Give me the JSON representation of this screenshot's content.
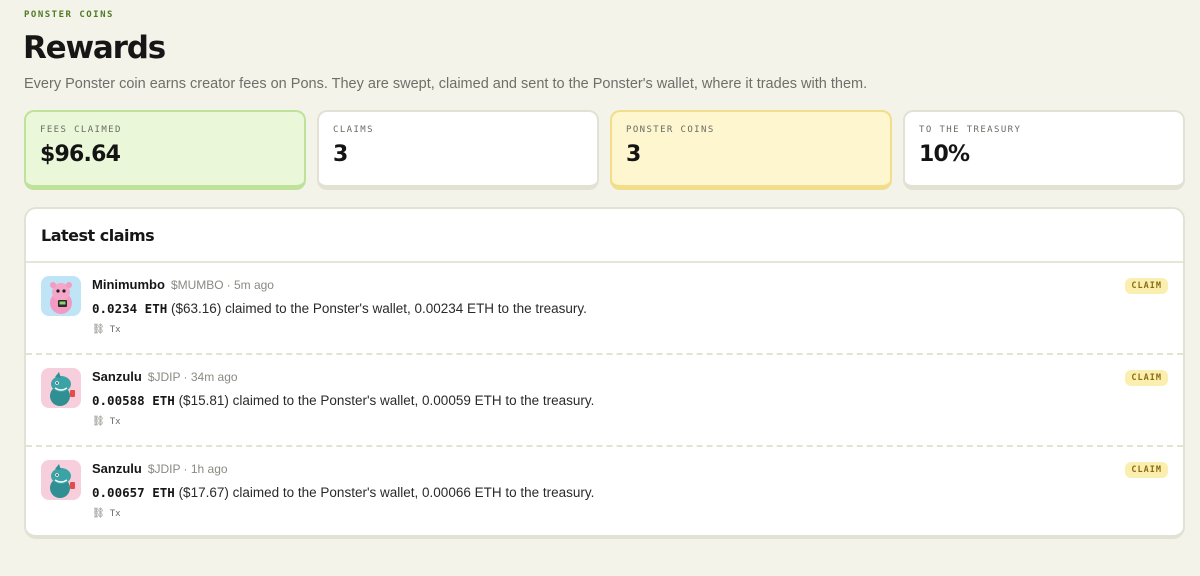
{
  "header": {
    "eyebrow": "PONSTER COINS",
    "title": "Rewards",
    "subtitle": "Every Ponster coin earns creator fees on Pons. They are swept, claimed and sent to the Ponster's wallet, where it trades with them."
  },
  "stats": [
    {
      "label": "FEES CLAIMED",
      "value": "$96.64",
      "tone": "green"
    },
    {
      "label": "CLAIMS",
      "value": "3",
      "tone": "white"
    },
    {
      "label": "PONSTER COINS",
      "value": "3",
      "tone": "yellow"
    },
    {
      "label": "TO THE TREASURY",
      "value": "10%",
      "tone": "white"
    }
  ],
  "claims_panel": {
    "title": "Latest claims",
    "rows": [
      {
        "name": "Minimumbo",
        "ticker": "$MUMBO",
        "time": "· 5m ago",
        "amount": "0.0234 ETH",
        "usd": "($63.16)",
        "text": "claimed to the Ponster's wallet, 0.00234 ETH to the treasury.",
        "tx": "Tx",
        "badge": "CLAIM",
        "avatar_icon": "pink-creature-icon"
      },
      {
        "name": "Sanzulu",
        "ticker": "$JDIP",
        "time": "· 34m ago",
        "amount": "0.00588 ETH",
        "usd": "($15.81)",
        "text": "claimed to the Ponster's wallet, 0.00059 ETH to the treasury.",
        "tx": "Tx",
        "badge": "CLAIM",
        "avatar_icon": "teal-creature-icon"
      },
      {
        "name": "Sanzulu",
        "ticker": "$JDIP",
        "time": "· 1h ago",
        "amount": "0.00657 ETH",
        "usd": "($17.67)",
        "text": "claimed to the Ponster's wallet, 0.00066 ETH to the treasury.",
        "tx": "Tx",
        "badge": "CLAIM",
        "avatar_icon": "teal-creature-icon"
      }
    ]
  },
  "colors": {
    "background": "#f3f3ea",
    "accent_green": "#eaf7d9",
    "accent_yellow": "#fdf6cf",
    "badge": "#fbefb0"
  }
}
